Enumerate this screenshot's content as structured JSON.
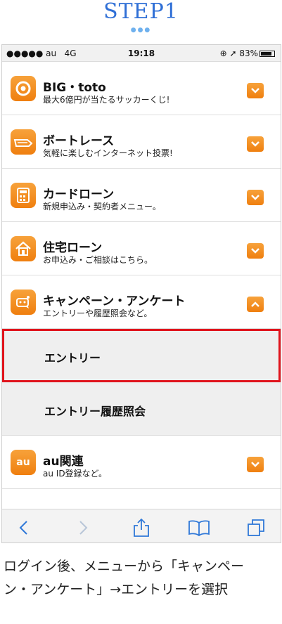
{
  "header": {
    "step": "STEP1",
    "dots": "●●●"
  },
  "status": {
    "signal": "●●●●● au",
    "network": "4G",
    "time": "19:18",
    "indicators": "⊕ ➚ 83%",
    "battery_level": 0.83
  },
  "menu": {
    "items": [
      {
        "title": "BIG・toto",
        "sub": "最大6億円が当たるサッカーくじ!",
        "expanded": false
      },
      {
        "title": "ボートレース",
        "sub": "気軽に楽しむインターネット投票!",
        "expanded": false
      },
      {
        "title": "カードローン",
        "sub": "新規申込み・契約者メニュー。",
        "expanded": false
      },
      {
        "title": "住宅ローン",
        "sub": "お申込み・ご相談はこちら。",
        "expanded": false
      },
      {
        "title": "キャンペーン・アンケート",
        "sub": "エントリーや履歴照会など。",
        "expanded": true
      }
    ],
    "subitems": [
      "エントリー",
      "エントリー履歴照会"
    ],
    "au": {
      "title": "au関連",
      "sub": "au ID登録など。",
      "icon_text": "au"
    }
  },
  "caption": {
    "line1": "ログイン後、メニューから「キャンペー",
    "line2": "ン・アンケート」→エントリーを選択"
  },
  "colors": {
    "accent": "#ef7f0f",
    "highlight": "#e0141c",
    "step": "#2f6fd6"
  }
}
